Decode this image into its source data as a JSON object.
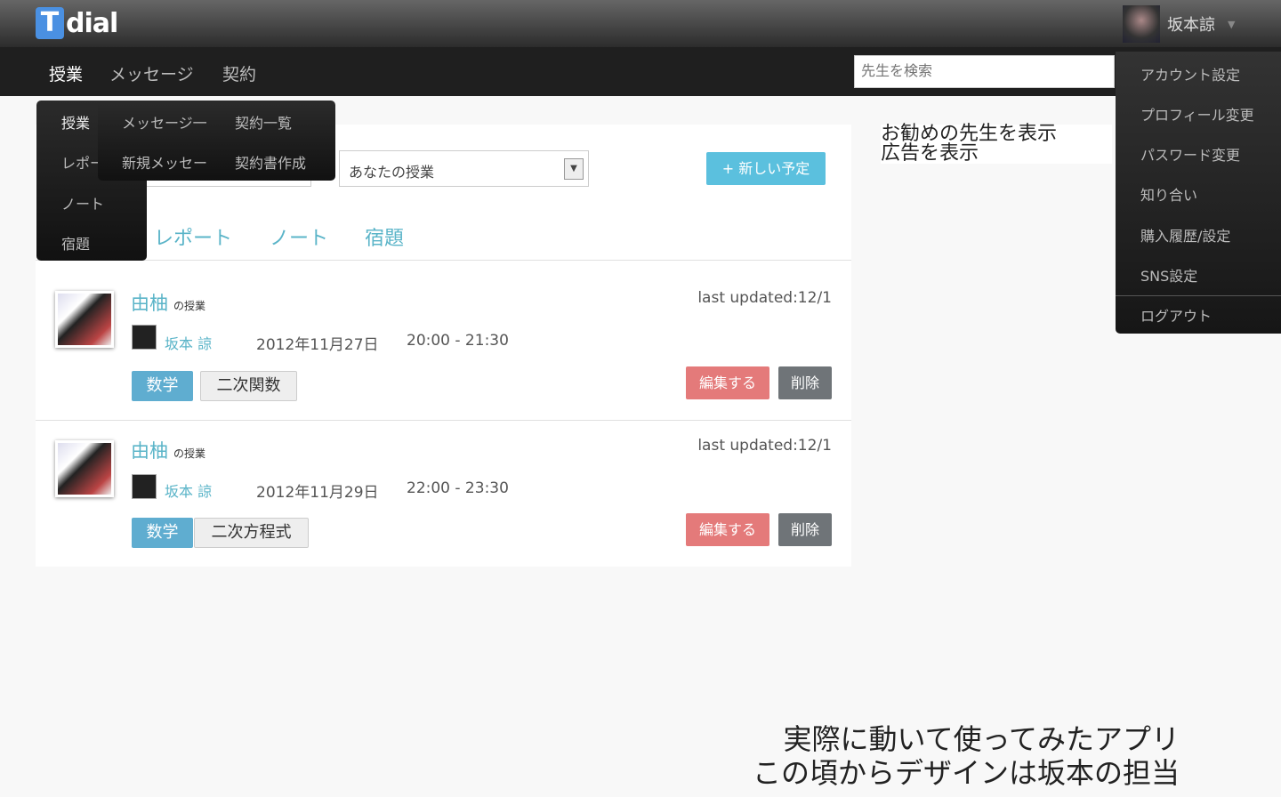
{
  "header": {
    "logo_t": "T",
    "logo_rest": "dial",
    "user_name": "坂本諒"
  },
  "nav": {
    "items": [
      "授業",
      "メッセージ",
      "契約"
    ],
    "search_placeholder": "先生を検索"
  },
  "dropdown_lessons": [
    "授業",
    "レポー",
    "ノート",
    "宿題"
  ],
  "dropdown_messages": [
    "メッセージ一",
    "新規メッセー"
  ],
  "dropdown_contracts": [
    "契約一覧",
    "契約書作成"
  ],
  "user_menu": [
    "アカウント設定",
    "プロフィール変更",
    "パスワード変更",
    "知り合い",
    "購入履歴/設定",
    "SNS設定",
    "ログアウト"
  ],
  "filter": {
    "select_value": "あなたの授業",
    "new_button": "+ 新しい予定"
  },
  "tabs": [
    "レポート",
    "ノート",
    "宿題"
  ],
  "lessons": [
    {
      "student": "由柚",
      "suffix": "の授業",
      "teacher": "坂本 諒",
      "date": "2012年11月27日",
      "time": "20:00  - 21:30",
      "updated": "last updated:12/1",
      "subject": "数学",
      "topic": "二次関数",
      "edit": "編集する",
      "delete": "削除"
    },
    {
      "student": "由柚",
      "suffix": "の授業",
      "teacher": "坂本 諒",
      "date": "2012年11月29日",
      "time": "22:00  - 23:30",
      "updated": "last updated:12/1",
      "subject": "数学",
      "topic": "二次方程式",
      "edit": "編集する",
      "delete": "削除"
    }
  ],
  "sidebar": {
    "line1": "お勧めの先生を表示",
    "line2": "広告を表示"
  },
  "caption": {
    "line1": "実際に動いて使ってみたアプリ",
    "line2": "この頃からデザインは坂本の担当"
  }
}
